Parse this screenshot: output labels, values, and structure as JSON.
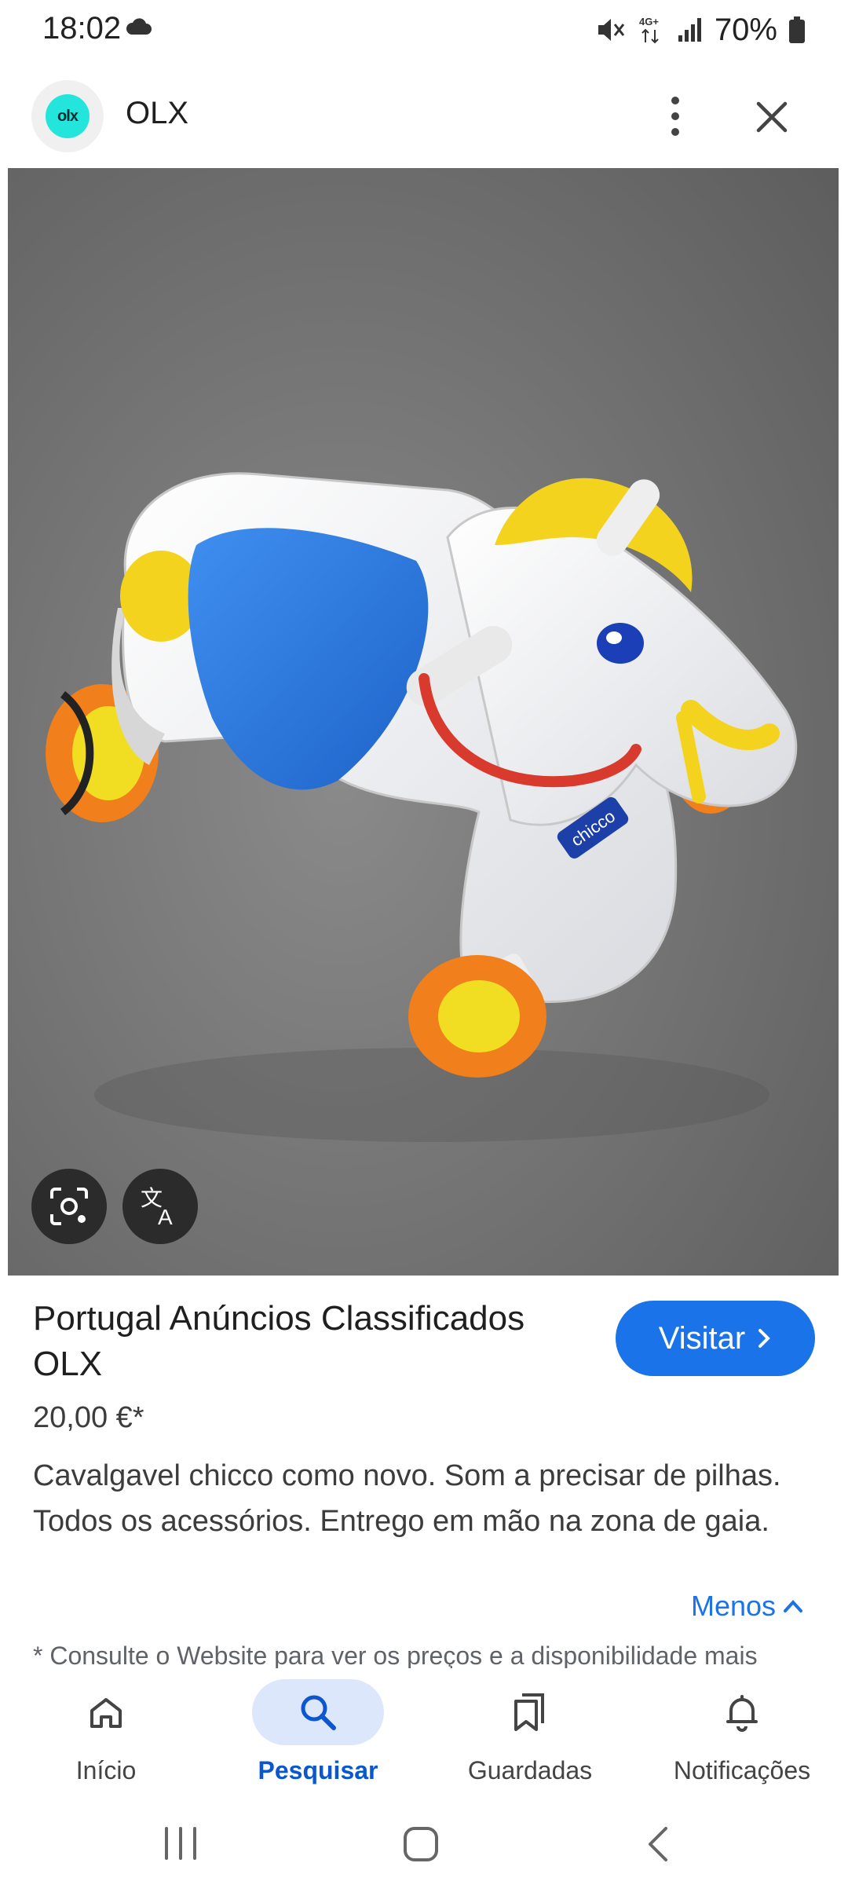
{
  "status_bar": {
    "time": "18:02",
    "battery": "70%"
  },
  "header": {
    "title": "OLX",
    "logo_text": "olx"
  },
  "result": {
    "site_name": "Portugal Anúncios Classificados OLX",
    "visit_label": "Visitar",
    "price": "20,00 €*",
    "description": "Cavalgavel chicco como novo. Som a precisar de pilhas. Todos os acessórios. Entrego em mão na zona de gaia.",
    "less_label": "Menos",
    "disclaimer": "* Consulte o Website para ver os preços e a disponibilidade mais"
  },
  "image": {
    "brand_label": "chicco"
  },
  "bottom_nav": {
    "items": [
      {
        "label": "Início",
        "icon": "home-icon"
      },
      {
        "label": "Pesquisar",
        "icon": "search-icon",
        "active": true
      },
      {
        "label": "Guardadas",
        "icon": "bookmarks-icon"
      },
      {
        "label": "Notificações",
        "icon": "bell-icon"
      }
    ]
  },
  "colors": {
    "accent": "#1a73e8",
    "active_nav_bg": "#dde7fb",
    "olx_teal": "#23e5db"
  }
}
